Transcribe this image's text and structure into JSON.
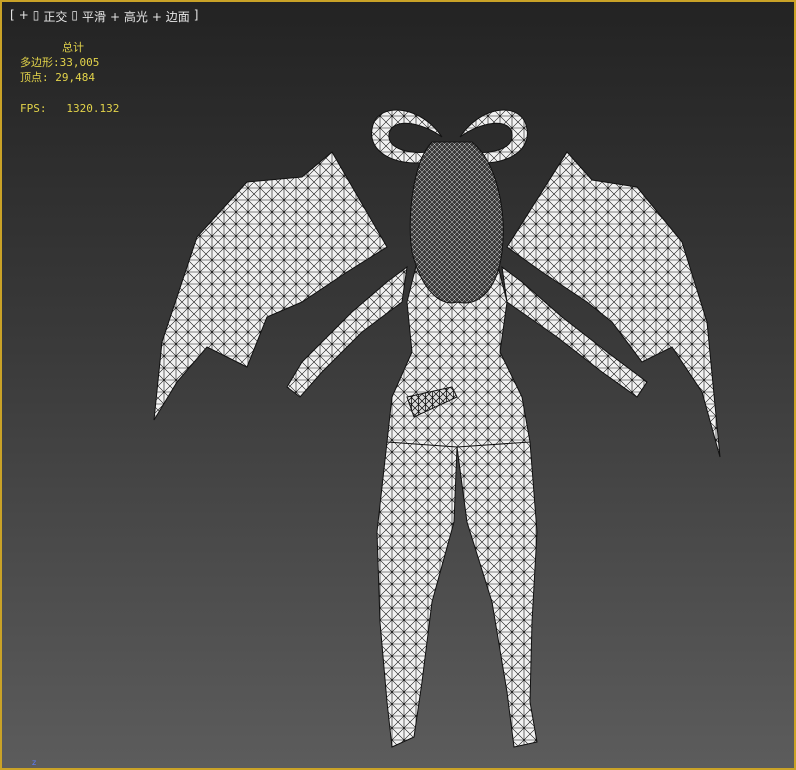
{
  "viewport": {
    "label_bracket_open": "[",
    "label_plus": "+",
    "label_view": "正交",
    "label_shading": "平滑",
    "label_highlight": "+ 高光",
    "label_edges": "+ 边面",
    "label_bracket_close": "]",
    "plus_icon": "plus-icon",
    "sep_icon": "separator-icon",
    "border_color": "#c9a227"
  },
  "stats": {
    "title": "总计",
    "polygons_label": "多边形:",
    "polygons_value": "33,005",
    "vertices_label": "顶点:",
    "vertices_value": "29,484",
    "fps_label": "FPS:",
    "fps_value": "1320.132",
    "color": "#e2d34a"
  },
  "axis": {
    "label": "z",
    "icon": "axis-gizmo-icon"
  }
}
